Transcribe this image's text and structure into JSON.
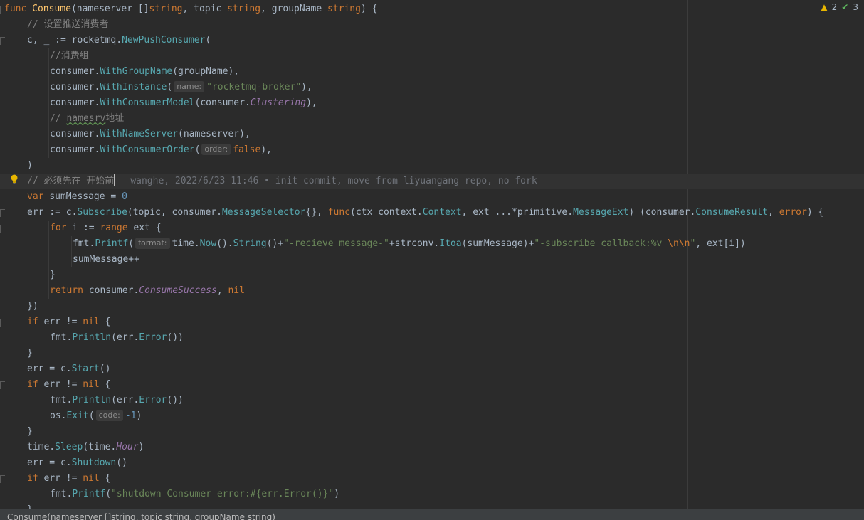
{
  "inspection": {
    "warnings": "2",
    "weak_warnings": "3"
  },
  "breadcrumb": "Consume(nameserver []string, topic string, groupName string)",
  "blame": "wanghe, 2022/6/23 11:46 • init commit, move from liyuangang repo, no fork",
  "lines": [
    [
      [
        "kw",
        "func "
      ],
      [
        "fn",
        "Consume"
      ],
      [
        "plain",
        "(nameserver []"
      ],
      [
        "kw",
        "string"
      ],
      [
        "plain",
        ", topic "
      ],
      [
        "kw",
        "string"
      ],
      [
        "plain",
        ", groupName "
      ],
      [
        "kw",
        "string"
      ],
      [
        "plain",
        ") {"
      ]
    ],
    [
      [
        "cm",
        "// 设置推送消费者"
      ]
    ],
    [
      [
        "plain",
        "c, _ := rocketmq."
      ],
      [
        "call",
        "NewPushConsumer"
      ],
      [
        "plain",
        "("
      ]
    ],
    [
      [
        "cm",
        "//消费组"
      ]
    ],
    [
      [
        "plain",
        "consumer."
      ],
      [
        "call",
        "WithGroupName"
      ],
      [
        "plain",
        "(groupName),"
      ]
    ],
    [
      [
        "plain",
        "consumer."
      ],
      [
        "call",
        "WithInstance"
      ],
      [
        "plain",
        "("
      ],
      [
        "hint",
        "name:"
      ],
      [
        "str",
        "\"rocketmq-broker\""
      ],
      [
        "plain",
        "),"
      ]
    ],
    [
      [
        "plain",
        "consumer."
      ],
      [
        "call",
        "WithConsumerModel"
      ],
      [
        "plain",
        "(consumer."
      ],
      [
        "purple",
        "Clustering"
      ],
      [
        "plain",
        "),"
      ]
    ],
    [
      [
        "cm",
        "// "
      ],
      [
        "cmsquig",
        "namesrv"
      ],
      [
        "cm",
        "地址"
      ]
    ],
    [
      [
        "plain",
        "consumer."
      ],
      [
        "call",
        "WithNameServer"
      ],
      [
        "plain",
        "(nameserver),"
      ]
    ],
    [
      [
        "plain",
        "consumer."
      ],
      [
        "call",
        "WithConsumerOrder"
      ],
      [
        "plain",
        "("
      ],
      [
        "hint",
        "order:"
      ],
      [
        "kw",
        "false"
      ],
      [
        "plain",
        "),"
      ]
    ],
    [
      [
        "plain",
        ")"
      ]
    ],
    [
      [
        "cm",
        "// 必须先在 开始前"
      ]
    ],
    [
      [
        "kw",
        "var "
      ],
      [
        "plain",
        "sumMessage = "
      ],
      [
        "num",
        "0"
      ]
    ],
    [
      [
        "plain",
        "err := c."
      ],
      [
        "call",
        "Subscribe"
      ],
      [
        "plain",
        "(topic, consumer."
      ],
      [
        "call",
        "MessageSelector"
      ],
      [
        "plain",
        "{}, "
      ],
      [
        "kw",
        "func"
      ],
      [
        "plain",
        "(ctx context."
      ],
      [
        "call",
        "Context"
      ],
      [
        "plain",
        ", ext ...*primitive."
      ],
      [
        "call",
        "MessageExt"
      ],
      [
        "plain",
        ") (consumer."
      ],
      [
        "call",
        "ConsumeResult"
      ],
      [
        "plain",
        ", "
      ],
      [
        "kw",
        "error"
      ],
      [
        "plain",
        ") {"
      ]
    ],
    [
      [
        "kw",
        "for "
      ],
      [
        "plain",
        "i := "
      ],
      [
        "kw",
        "range "
      ],
      [
        "plain",
        "ext {"
      ]
    ],
    [
      [
        "plain",
        "fmt."
      ],
      [
        "call",
        "Printf"
      ],
      [
        "plain",
        "("
      ],
      [
        "hint",
        "format:"
      ],
      [
        "plain",
        "time."
      ],
      [
        "call",
        "Now"
      ],
      [
        "plain",
        "()."
      ],
      [
        "call",
        "String"
      ],
      [
        "plain",
        "()+"
      ],
      [
        "str",
        "\"-recieve message-\""
      ],
      [
        "plain",
        "+strconv."
      ],
      [
        "call",
        "Itoa"
      ],
      [
        "plain",
        "(sumMessage)+"
      ],
      [
        "str",
        "\"-subscribe callback:%v "
      ],
      [
        "esc",
        "\\n\\n"
      ],
      [
        "str",
        "\""
      ],
      [
        "plain",
        ", ext[i])"
      ]
    ],
    [
      [
        "plain",
        "sumMessage++"
      ]
    ],
    [
      [
        "plain",
        "}"
      ]
    ],
    [
      [
        "kw",
        "return "
      ],
      [
        "plain",
        "consumer."
      ],
      [
        "purple",
        "ConsumeSuccess"
      ],
      [
        "plain",
        ", "
      ],
      [
        "kw",
        "nil"
      ]
    ],
    [
      [
        "plain",
        "})"
      ]
    ],
    [
      [
        "kw",
        "if "
      ],
      [
        "plain",
        "err != "
      ],
      [
        "kw",
        "nil "
      ],
      [
        "plain",
        "{"
      ]
    ],
    [
      [
        "plain",
        "fmt."
      ],
      [
        "call",
        "Println"
      ],
      [
        "plain",
        "(err."
      ],
      [
        "call",
        "Error"
      ],
      [
        "plain",
        "())"
      ]
    ],
    [
      [
        "plain",
        "}"
      ]
    ],
    [
      [
        "plain",
        "err = c."
      ],
      [
        "call",
        "Start"
      ],
      [
        "plain",
        "()"
      ]
    ],
    [
      [
        "kw",
        "if "
      ],
      [
        "plain",
        "err != "
      ],
      [
        "kw",
        "nil "
      ],
      [
        "plain",
        "{"
      ]
    ],
    [
      [
        "plain",
        "fmt."
      ],
      [
        "call",
        "Println"
      ],
      [
        "plain",
        "(err."
      ],
      [
        "call",
        "Error"
      ],
      [
        "plain",
        "())"
      ]
    ],
    [
      [
        "plain",
        "os."
      ],
      [
        "call",
        "Exit"
      ],
      [
        "plain",
        "("
      ],
      [
        "hint",
        "code:"
      ],
      [
        "num",
        "-1"
      ],
      [
        "plain",
        ")"
      ]
    ],
    [
      [
        "plain",
        "}"
      ]
    ],
    [
      [
        "plain",
        "time."
      ],
      [
        "call",
        "Sleep"
      ],
      [
        "plain",
        "(time."
      ],
      [
        "purple",
        "Hour"
      ],
      [
        "plain",
        ")"
      ]
    ],
    [
      [
        "plain",
        "err = c."
      ],
      [
        "call",
        "Shutdown"
      ],
      [
        "plain",
        "()"
      ]
    ],
    [
      [
        "kw",
        "if "
      ],
      [
        "plain",
        "err != "
      ],
      [
        "kw",
        "nil "
      ],
      [
        "plain",
        "{"
      ]
    ],
    [
      [
        "plain",
        "fmt."
      ],
      [
        "call",
        "Printf"
      ],
      [
        "plain",
        "("
      ],
      [
        "str",
        "\"shutdown Consumer error:#{err.Error()}\""
      ],
      [
        "plain",
        ")"
      ]
    ],
    [
      [
        "plain",
        "}"
      ]
    ]
  ]
}
